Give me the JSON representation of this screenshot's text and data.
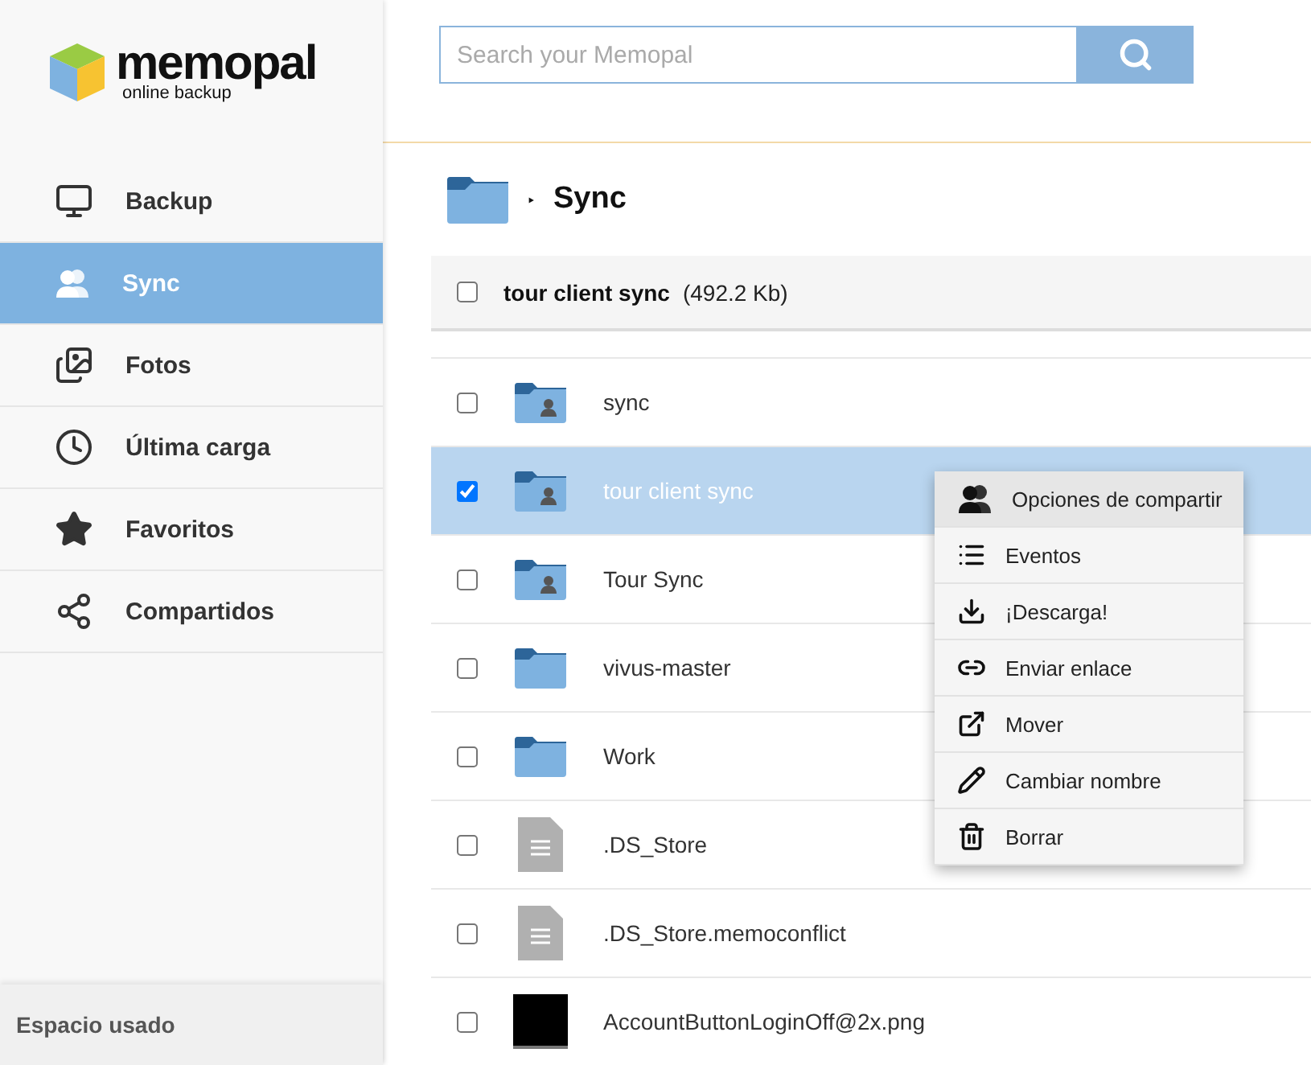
{
  "logo": {
    "name": "memopal",
    "tagline": "online backup"
  },
  "sidebar": {
    "items": [
      {
        "label": "Backup",
        "selected": false
      },
      {
        "label": "Sync",
        "selected": true
      },
      {
        "label": "Fotos",
        "selected": false
      },
      {
        "label": "Última carga",
        "selected": false
      },
      {
        "label": "Favoritos",
        "selected": false
      },
      {
        "label": "Compartidos",
        "selected": false
      }
    ],
    "footer": "Espacio usado"
  },
  "search": {
    "placeholder": "Search your Memopal"
  },
  "breadcrumb": {
    "separator": "‣",
    "current": "Sync"
  },
  "selection": {
    "name": "tour client sync",
    "size": "(492.2 Kb)",
    "checked": false
  },
  "files": [
    {
      "name": "sync",
      "kind": "shared-folder",
      "checked": false,
      "selected": false
    },
    {
      "name": "tour client sync",
      "kind": "shared-folder",
      "checked": true,
      "selected": true
    },
    {
      "name": "Tour Sync",
      "kind": "shared-folder",
      "checked": false,
      "selected": false
    },
    {
      "name": "vivus-master",
      "kind": "folder",
      "checked": false,
      "selected": false
    },
    {
      "name": "Work",
      "kind": "folder",
      "checked": false,
      "selected": false
    },
    {
      "name": ".DS_Store",
      "kind": "file",
      "checked": false,
      "selected": false
    },
    {
      "name": ".DS_Store.memoconflict",
      "kind": "file",
      "checked": false,
      "selected": false
    },
    {
      "name": "AccountButtonLoginOff@2x.png",
      "kind": "image",
      "checked": false,
      "selected": false
    }
  ],
  "context_menu": [
    {
      "label": "Opciones de compartir",
      "selected": true
    },
    {
      "label": "Eventos",
      "selected": false
    },
    {
      "label": "¡Descarga!",
      "selected": false
    },
    {
      "label": "Enviar enlace",
      "selected": false
    },
    {
      "label": "Mover",
      "selected": false
    },
    {
      "label": "Cambiar nombre",
      "selected": false
    },
    {
      "label": "Borrar",
      "selected": false
    }
  ]
}
